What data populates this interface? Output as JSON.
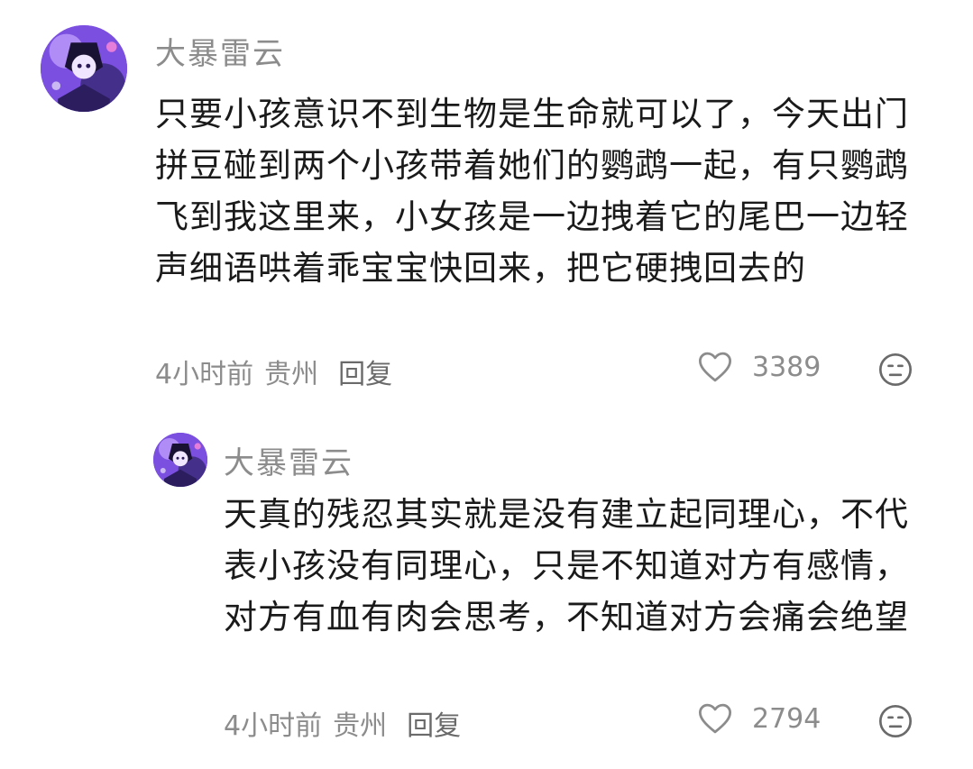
{
  "comments": [
    {
      "username": "大暴雷云",
      "text": "只要小孩意识不到生物是生命就可以了，今天出门拼豆碰到两个小孩带着她们的鹦鹉一起，有只鹦鹉飞到我这里来，小女孩是一边拽着它的尾巴一边轻声细语哄着乖宝宝快回来，把它硬拽回去的",
      "time": "4小时前",
      "location": "贵州",
      "reply_label": "回复",
      "likes": "3389",
      "avatar_icon": "user-avatar"
    },
    {
      "username": "大暴雷云",
      "text": "天真的残忍其实就是没有建立起同理心，不代表小孩没有同理心，只是不知道对方有感情，对方有血有肉会思考，不知道对方会痛会绝望",
      "time": "4小时前",
      "location": "贵州",
      "reply_label": "回复",
      "likes": "2794",
      "avatar_icon": "user-avatar"
    }
  ],
  "icons": {
    "like": "heart-outline-icon",
    "dislike": "unhappy-face-icon"
  },
  "colors": {
    "text_primary": "#1a1a1a",
    "text_secondary": "#8c8c8c",
    "avatar_accent": "#8a5cf0"
  }
}
